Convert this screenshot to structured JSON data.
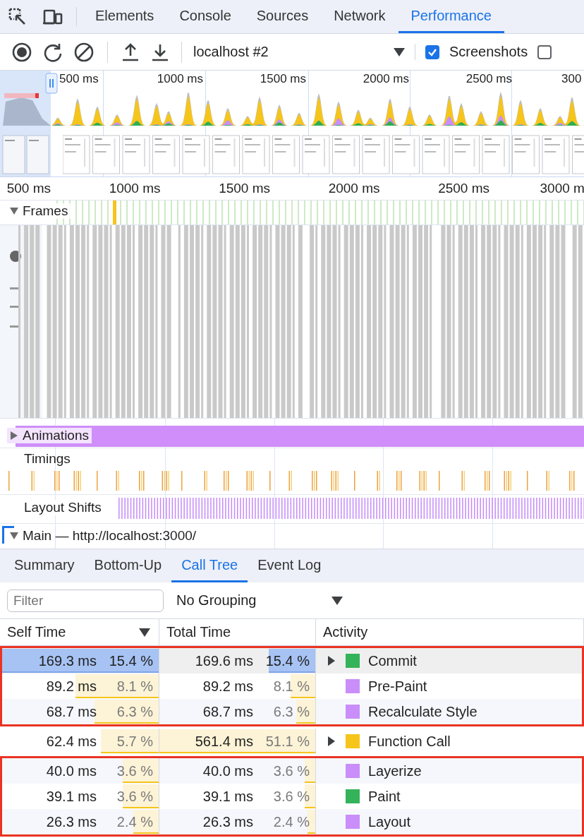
{
  "panel_tabs": [
    {
      "label": "Elements",
      "selected": false
    },
    {
      "label": "Console",
      "selected": false
    },
    {
      "label": "Sources",
      "selected": false
    },
    {
      "label": "Network",
      "selected": false
    },
    {
      "label": "Performance",
      "selected": true
    }
  ],
  "toolbar": {
    "target": "localhost #2",
    "checkboxes": [
      {
        "label": "Screenshots",
        "checked": true
      },
      {
        "checked": false
      }
    ]
  },
  "overview": {
    "ticks": [
      "500 ms",
      "1000 ms",
      "1500 ms",
      "2000 ms",
      "2500 ms",
      "300"
    ]
  },
  "ruler": {
    "ticks": [
      "500 ms",
      "1000 ms",
      "1500 ms",
      "2000 ms",
      "2500 ms",
      "3000 m"
    ]
  },
  "tracks": [
    {
      "kind": "frames",
      "label": "Frames",
      "expanded": true
    },
    {
      "kind": "animations",
      "label": "Animations",
      "expanded": false
    },
    {
      "kind": "timings",
      "label": "Timings"
    },
    {
      "kind": "shifts",
      "label": "Layout Shifts"
    },
    {
      "kind": "main",
      "label": "Main — http://localhost:3000/",
      "expanded": true
    }
  ],
  "details_tabs": [
    {
      "label": "Summary",
      "selected": false
    },
    {
      "label": "Bottom-Up",
      "selected": false
    },
    {
      "label": "Call Tree",
      "selected": true
    },
    {
      "label": "Event Log",
      "selected": false
    }
  ],
  "filter": {
    "placeholder": "Filter"
  },
  "grouping": "No Grouping",
  "table": {
    "columns": [
      {
        "label": "Self Time",
        "sorted": true
      },
      {
        "label": "Total Time",
        "sorted": false
      },
      {
        "label": "Activity",
        "sorted": false
      }
    ],
    "row_groups": [
      {
        "highlighted": true,
        "rows": [
          {
            "self": "169.3 ms",
            "self_percent": "15.4 %",
            "self_bar": {
              "level": 1
            },
            "total": "169.6 ms",
            "total_percent": "15.4 %",
            "total_bar": {
              "level": 0.3
            },
            "activity": "Commit",
            "color": "#34b35a",
            "expandable": true,
            "selected": true
          },
          {
            "self": "89.2 ms",
            "self_percent": "8.1 %",
            "self_bar": {
              "level": 0.53
            },
            "total": "89.2 ms",
            "total_percent": "8.1 %",
            "total_bar": {
              "level": 0.16
            },
            "activity": "Pre-Paint",
            "color": "#c98ef9",
            "expandable": false,
            "selected": false
          },
          {
            "self": "68.7 ms",
            "self_percent": "6.3 %",
            "self_bar": {
              "level": 0.41
            },
            "total": "68.7 ms",
            "total_percent": "6.3 %",
            "total_bar": {
              "level": 0.12
            },
            "activity": "Recalculate Style",
            "color": "#c98ef9",
            "expandable": false,
            "selected": false
          }
        ]
      },
      {
        "highlighted": false,
        "rows": [
          {
            "self": "62.4 ms",
            "self_percent": "5.7 %",
            "self_bar": {
              "level": 0.37
            },
            "total": "561.4 ms",
            "total_percent": "51.1 %",
            "total_bar": {
              "level": 1
            },
            "activity": "Function Call",
            "color": "#f6c51b",
            "expandable": true,
            "selected": false
          }
        ]
      },
      {
        "highlighted": true,
        "rows": [
          {
            "self": "40.0 ms",
            "self_percent": "3.6 %",
            "self_bar": {
              "level": 0.23
            },
            "total": "40.0 ms",
            "total_percent": "3.6 %",
            "total_bar": {
              "level": 0.07
            },
            "activity": "Layerize",
            "color": "#c98ef9",
            "expandable": false,
            "selected": false
          },
          {
            "self": "39.1 ms",
            "self_percent": "3.6 %",
            "self_bar": {
              "level": 0.23
            },
            "total": "39.1 ms",
            "total_percent": "3.6 %",
            "total_bar": {
              "level": 0.07
            },
            "activity": "Paint",
            "color": "#34b35a",
            "expandable": false,
            "selected": false
          },
          {
            "self": "26.3 ms",
            "self_percent": "2.4 %",
            "self_bar": {
              "level": 0.16
            },
            "total": "26.3 ms",
            "total_percent": "2.4 %",
            "total_bar": {
              "level": 0.05
            },
            "activity": "Layout",
            "color": "#c98ef9",
            "expandable": false,
            "selected": false
          }
        ]
      }
    ]
  }
}
